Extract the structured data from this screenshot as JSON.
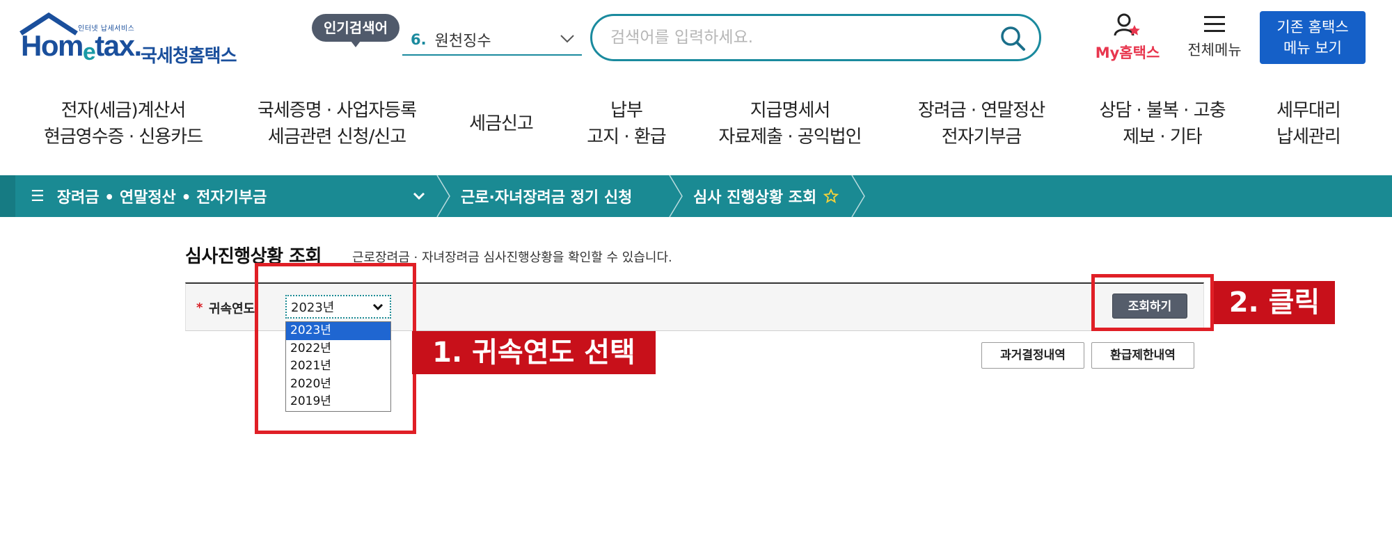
{
  "header": {
    "logo_small": "인터넷 납세서비스",
    "logo_word_pre": "Hom",
    "logo_word_e": "e",
    "logo_word_post": "tax.",
    "logo_kr": "국세청홈택스",
    "popular_tag": "인기검색어",
    "popular_rank": "6.",
    "popular_term": "원천징수",
    "search_placeholder": "검색어를 입력하세요.",
    "my_label": "My홈택스",
    "all_menu_label": "전체메뉴",
    "old_menu_line1": "기존 홈택스",
    "old_menu_line2": "메뉴 보기"
  },
  "nav": [
    {
      "line1": "전자(세금)계산서",
      "line2": "현금영수증 · 신용카드"
    },
    {
      "line1": "국세증명 · 사업자등록",
      "line2": "세금관련 신청/신고"
    },
    {
      "line1": "세금신고",
      "line2": ""
    },
    {
      "line1": "납부",
      "line2": "고지 · 환급"
    },
    {
      "line1": "지급명세서",
      "line2": "자료제출 · 공익법인"
    },
    {
      "line1": "장려금 · 연말정산",
      "line2": "전자기부금"
    },
    {
      "line1": "상담 · 불복 · 고충",
      "line2": "제보 · 기타"
    },
    {
      "line1": "세무대리",
      "line2": "납세관리"
    }
  ],
  "breadcrumb": {
    "home": "장려금 • 연말정산 • 전자기부금",
    "item1": "근로·자녀장려금 정기 신청",
    "item2": "심사 진행상황 조회"
  },
  "content": {
    "title": "심사진행상황 조회",
    "desc": "근로장려금 · 자녀장려금 심사진행상황을 확인할 수 있습니다.",
    "required_mark": "*",
    "field_label": "귀속연도",
    "selected_year": "2023년",
    "year_options": [
      "2023년",
      "2022년",
      "2021년",
      "2020년",
      "2019년"
    ],
    "search_button": "조회하기",
    "past_button": "과거결정내역",
    "refund_button": "환급제한내역"
  },
  "annotations": {
    "step1": "1. 귀속연도 선택",
    "step2": "2. 클릭"
  },
  "colors": {
    "teal": "#1a8a93",
    "brand_blue": "#1a4f9c",
    "annotation_red": "#e01f26",
    "my_pink": "#e8364e"
  }
}
